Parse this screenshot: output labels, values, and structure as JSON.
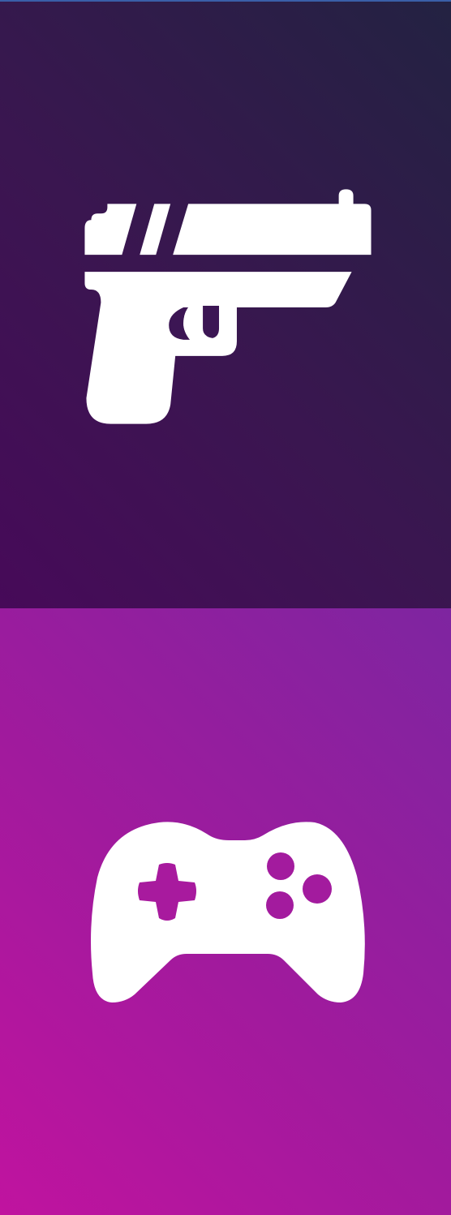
{
  "tiles": [
    {
      "name": "pistol-tile",
      "icon": "pistol-icon",
      "gradient": [
        "#470a59",
        "#3a1650",
        "#232242"
      ],
      "icon_color": "#ffffff"
    },
    {
      "name": "gamepad-tile",
      "icon": "gamepad-icon",
      "gradient": [
        "#c0139f",
        "#a11a9d",
        "#7e25a0"
      ],
      "icon_color": "#ffffff"
    }
  ]
}
